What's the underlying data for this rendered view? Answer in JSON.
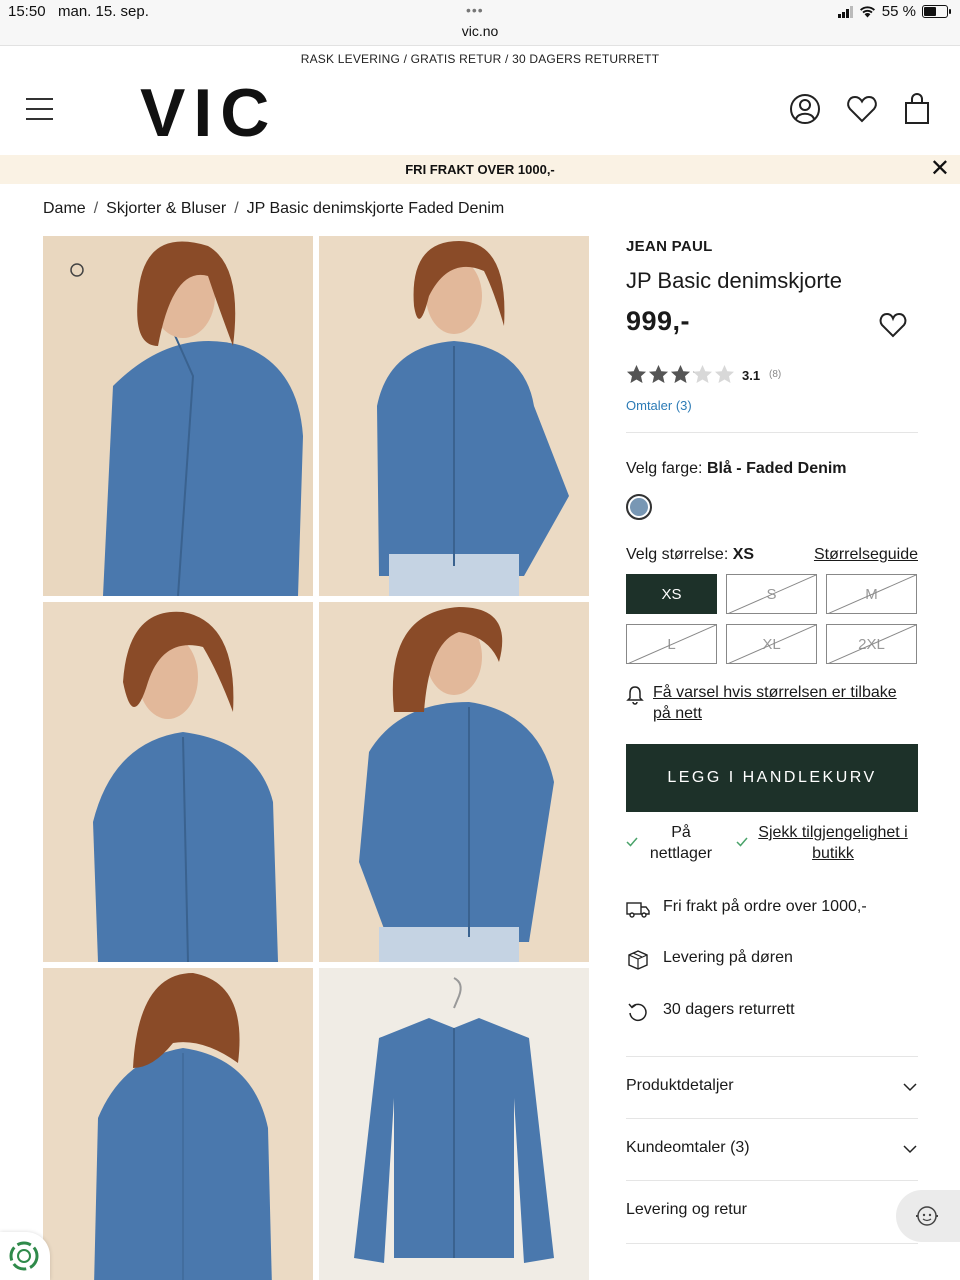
{
  "statusbar": {
    "time": "15:50",
    "date": "man. 15. sep.",
    "dots": "•••",
    "url": "vic.no",
    "battery": "55 %",
    "battery_level": 0.55
  },
  "topstrip": "RASK LEVERING / GRATIS RETUR / 30 DAGERS RETURRETT",
  "header": {
    "logo": "VIC",
    "icons": [
      "menu-icon",
      "account-icon",
      "heart-icon",
      "shopping-bag-icon"
    ]
  },
  "promo": {
    "text": "FRI FRAKT OVER 1000,-",
    "close": "✕"
  },
  "breadcrumb": [
    "Dame",
    "Skjorter & Bluser",
    "JP Basic denimskjorte Faded Denim"
  ],
  "product": {
    "brand": "JEAN PAUL",
    "name": "JP Basic denimskjorte",
    "price": "999,-",
    "rating": "3.1",
    "rating_value": 3.1,
    "rating_count": "(8)",
    "reviews_link": "Omtaler (3)",
    "color_label": "Velg farge:",
    "color_value": "Blå - Faded Denim",
    "swatch_color": "#7897b4",
    "size_label": "Velg størrelse:",
    "size_value": "XS",
    "size_guide": "Størrelseguide",
    "sizes": [
      {
        "label": "XS",
        "available": true,
        "selected": true
      },
      {
        "label": "S",
        "available": false
      },
      {
        "label": "M",
        "available": false
      },
      {
        "label": "L",
        "available": false
      },
      {
        "label": "XL",
        "available": false
      },
      {
        "label": "2XL",
        "available": false
      }
    ],
    "notify": "Få varsel hvis størrelsen er tilbake på nett",
    "cta": "LEGG I HANDLEKURV",
    "availability_online": "På nettlager",
    "availability_store": "Sjekk tilgjengelighet i butikk",
    "features": [
      {
        "icon": "truck-icon",
        "text": "Fri frakt på ordre over 1000,-"
      },
      {
        "icon": "package-icon",
        "text": "Levering på døren"
      },
      {
        "icon": "return-icon",
        "text": "30 dagers returrett"
      }
    ],
    "accordions": [
      "Produktdetaljer",
      "Kundeomtaler (3)",
      "Levering og retur"
    ]
  },
  "colors": {
    "accent": "#1d3129",
    "promo_bg": "#faf2e4",
    "link": "#2c7bb6",
    "denim": "#4a78ad",
    "photo_bg": "#e8d8c3"
  }
}
